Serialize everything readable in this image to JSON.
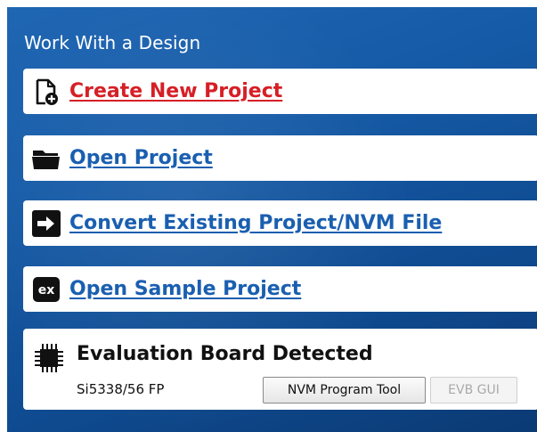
{
  "panel": {
    "title": "Work With a Design"
  },
  "actions": [
    {
      "label": "Create New Project",
      "icon": "new-file-icon",
      "color": "#d61f26"
    },
    {
      "label": "Open Project",
      "icon": "folder-icon",
      "color": "#1a5fb0"
    },
    {
      "label": "Convert Existing Project/NVM File",
      "icon": "convert-arrow-icon",
      "color": "#1a5fb0"
    },
    {
      "label": "Open Sample Project",
      "icon": "ex-icon",
      "icon_text": "ex",
      "color": "#1a5fb0"
    }
  ],
  "evaluation": {
    "title": "Evaluation Board Detected",
    "device": "Si5338/56 FP",
    "nvm_button": "NVM Program Tool",
    "evb_button": "EVB GUI",
    "icon": "chip-icon"
  },
  "colors": {
    "panel_bg": "#1a5fb0",
    "link": "#1a5fb0",
    "link_active": "#d61f26"
  }
}
